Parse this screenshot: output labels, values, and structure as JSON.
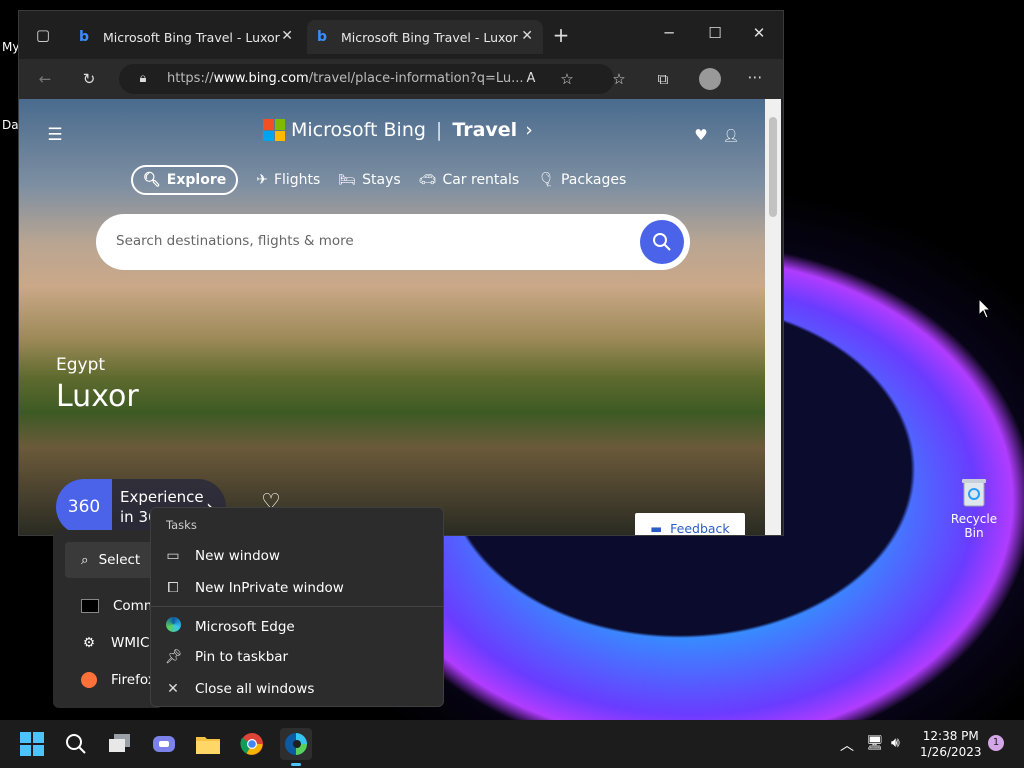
{
  "desktop": {
    "left_text_1": "My",
    "left_text_2": "Da",
    "recycle_bin_label": "Recycle Bin"
  },
  "browser": {
    "tabs": [
      {
        "title": "Microsoft Bing Travel - Luxor"
      },
      {
        "title": "Microsoft Bing Travel - Luxor"
      }
    ],
    "url_prefix": "https://",
    "url_host": "www.bing.com",
    "url_rest": "/travel/place-information?q=Lu..."
  },
  "page": {
    "brand": "Microsoft Bing",
    "section": "Travel",
    "nav": {
      "explore": "Explore",
      "flights": "Flights",
      "stays": "Stays",
      "car_rentals": "Car rentals",
      "packages": "Packages"
    },
    "search_placeholder": "Search destinations, flights & more",
    "country": "Egypt",
    "city": "Luxor",
    "experience_360_badge": "360",
    "experience_label_1": "Experience",
    "experience_label_2": "in 360°",
    "feedback": "Feedback"
  },
  "jumplist": {
    "search_label": "Select",
    "items": [
      "Comm",
      "WMIC.",
      "Firefox"
    ]
  },
  "context_menu": {
    "header": "Tasks",
    "new_window": "New window",
    "new_inprivate": "New InPrivate window",
    "edge": "Microsoft Edge",
    "pin": "Pin to taskbar",
    "close_all": "Close all windows"
  },
  "taskbar": {
    "time": "12:38 PM",
    "date": "1/26/2023",
    "notification_count": "1"
  },
  "colors": {
    "bing_blue": "#4a63e8",
    "taskbar": "#1c1c1c"
  }
}
